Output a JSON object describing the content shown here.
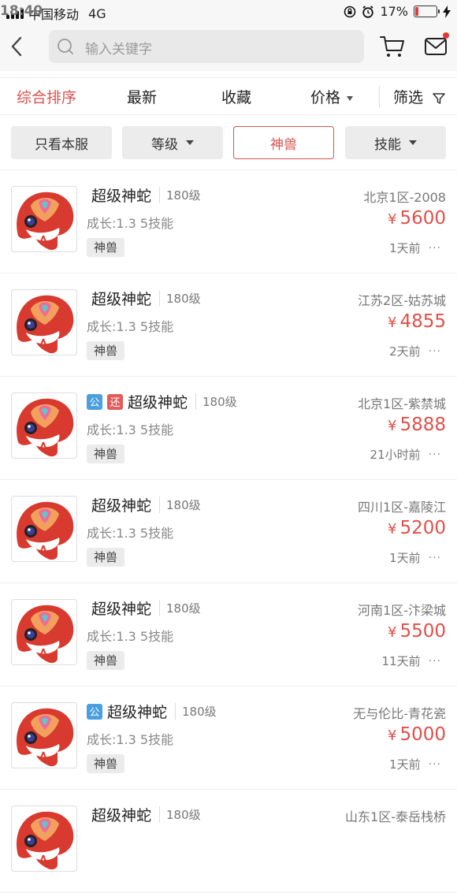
{
  "status_bar": {
    "carrier": "中国移动",
    "network": "4G",
    "time": "18:40",
    "battery": "17%",
    "battery_level": 0.17
  },
  "search": {
    "placeholder": "输入关键字"
  },
  "sort_tabs": [
    {
      "label": "综合排序",
      "active": true
    },
    {
      "label": "最新"
    },
    {
      "label": "收藏"
    },
    {
      "label": "价格"
    },
    {
      "label": "筛选"
    }
  ],
  "filters": [
    {
      "label": "只看本服"
    },
    {
      "label": "等级"
    },
    {
      "label": "神兽",
      "selected": true
    },
    {
      "label": "技能"
    }
  ],
  "colors": {
    "accent": "#e0504a",
    "badge_gong": "#4a9fe0",
    "badge_huan": "#e35b5b"
  },
  "items": [
    {
      "name": "超级神蛇",
      "level": "180级",
      "attrs": "成长:1.3 5技能",
      "tag": "神兽",
      "server": "北京1区-2008",
      "price": "5600",
      "time": "1天前",
      "badges": []
    },
    {
      "name": "超级神蛇",
      "level": "180级",
      "attrs": "成长:1.3 5技能",
      "tag": "神兽",
      "server": "江苏2区-姑苏城",
      "price": "4855",
      "time": "2天前",
      "badges": []
    },
    {
      "name": "超级神蛇",
      "level": "180级",
      "attrs": "成长:1.3 5技能",
      "tag": "神兽",
      "server": "北京1区-紫禁城",
      "price": "5888",
      "time": "21小时前",
      "badges": [
        "公",
        "还"
      ]
    },
    {
      "name": "超级神蛇",
      "level": "180级",
      "attrs": "成长:1.3 5技能",
      "tag": "神兽",
      "server": "四川1区-嘉陵江",
      "price": "5200",
      "time": "1天前",
      "badges": []
    },
    {
      "name": "超级神蛇",
      "level": "180级",
      "attrs": "成长:1.3 5技能",
      "tag": "神兽",
      "server": "河南1区-汴梁城",
      "price": "5500",
      "time": "11天前",
      "badges": []
    },
    {
      "name": "超级神蛇",
      "level": "180级",
      "attrs": "成长:1.3 5技能",
      "tag": "神兽",
      "server": "无与伦比-青花瓷",
      "price": "5000",
      "time": "1天前",
      "badges": [
        "公"
      ]
    },
    {
      "name": "超级神蛇",
      "level": "180级",
      "attrs": "",
      "tag": "",
      "server": "山东1区-泰岳栈桥",
      "price": "",
      "time": "",
      "badges": []
    }
  ],
  "currency_symbol": "¥",
  "more_icon": "···"
}
